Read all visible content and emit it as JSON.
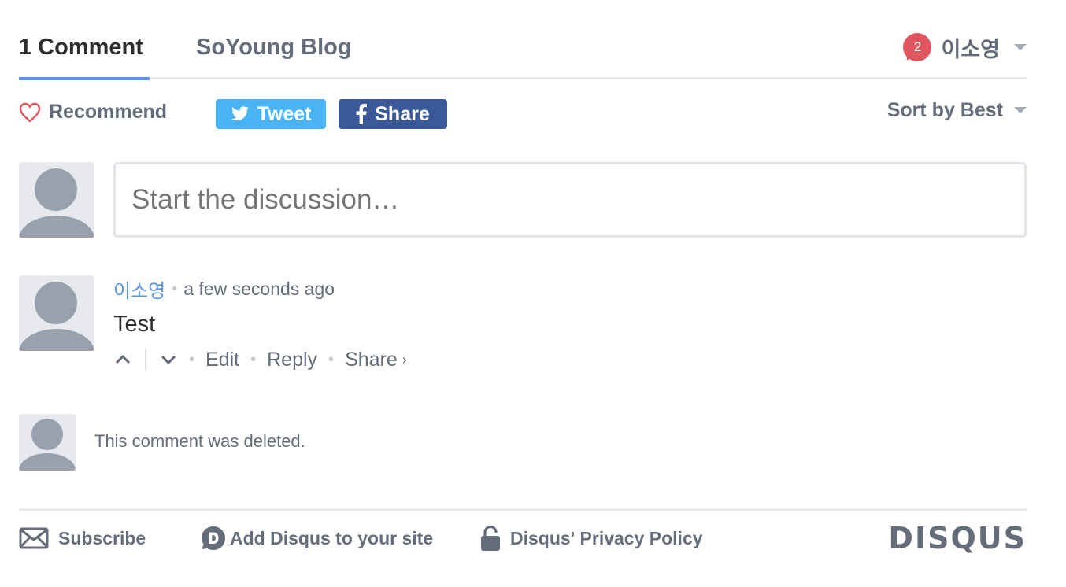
{
  "nav": {
    "comment_count_tab": "1 Comment",
    "forum_tab": "SoYoung Blog",
    "notification_count": "2",
    "user_name": "이소영"
  },
  "actions": {
    "recommend_label": "Recommend",
    "tweet_label": "Tweet",
    "share_label": "Share",
    "sort_label": "Sort by Best"
  },
  "composer": {
    "placeholder": "Start the discussion…"
  },
  "comments": [
    {
      "author": "이소영",
      "time": "a few seconds ago",
      "body": "Test",
      "edit_label": "Edit",
      "reply_label": "Reply",
      "share_label": "Share"
    }
  ],
  "deleted_comment": {
    "text": "This comment was deleted."
  },
  "footer": {
    "subscribe_label": "Subscribe",
    "add_disqus_label": "Add Disqus to your site",
    "privacy_label": "Disqus' Privacy Policy",
    "brand": "DISQUS"
  },
  "colors": {
    "accent": "#5b94e8",
    "badge": "#e0565f",
    "twitter": "#4ab3f4",
    "facebook": "#3b5998",
    "text_muted": "#656c7a"
  },
  "icons": [
    "heart-icon",
    "twitter-bird-icon",
    "facebook-f-icon",
    "upvote-icon",
    "downvote-icon",
    "envelope-icon",
    "disqus-d-icon",
    "lock-icon"
  ]
}
